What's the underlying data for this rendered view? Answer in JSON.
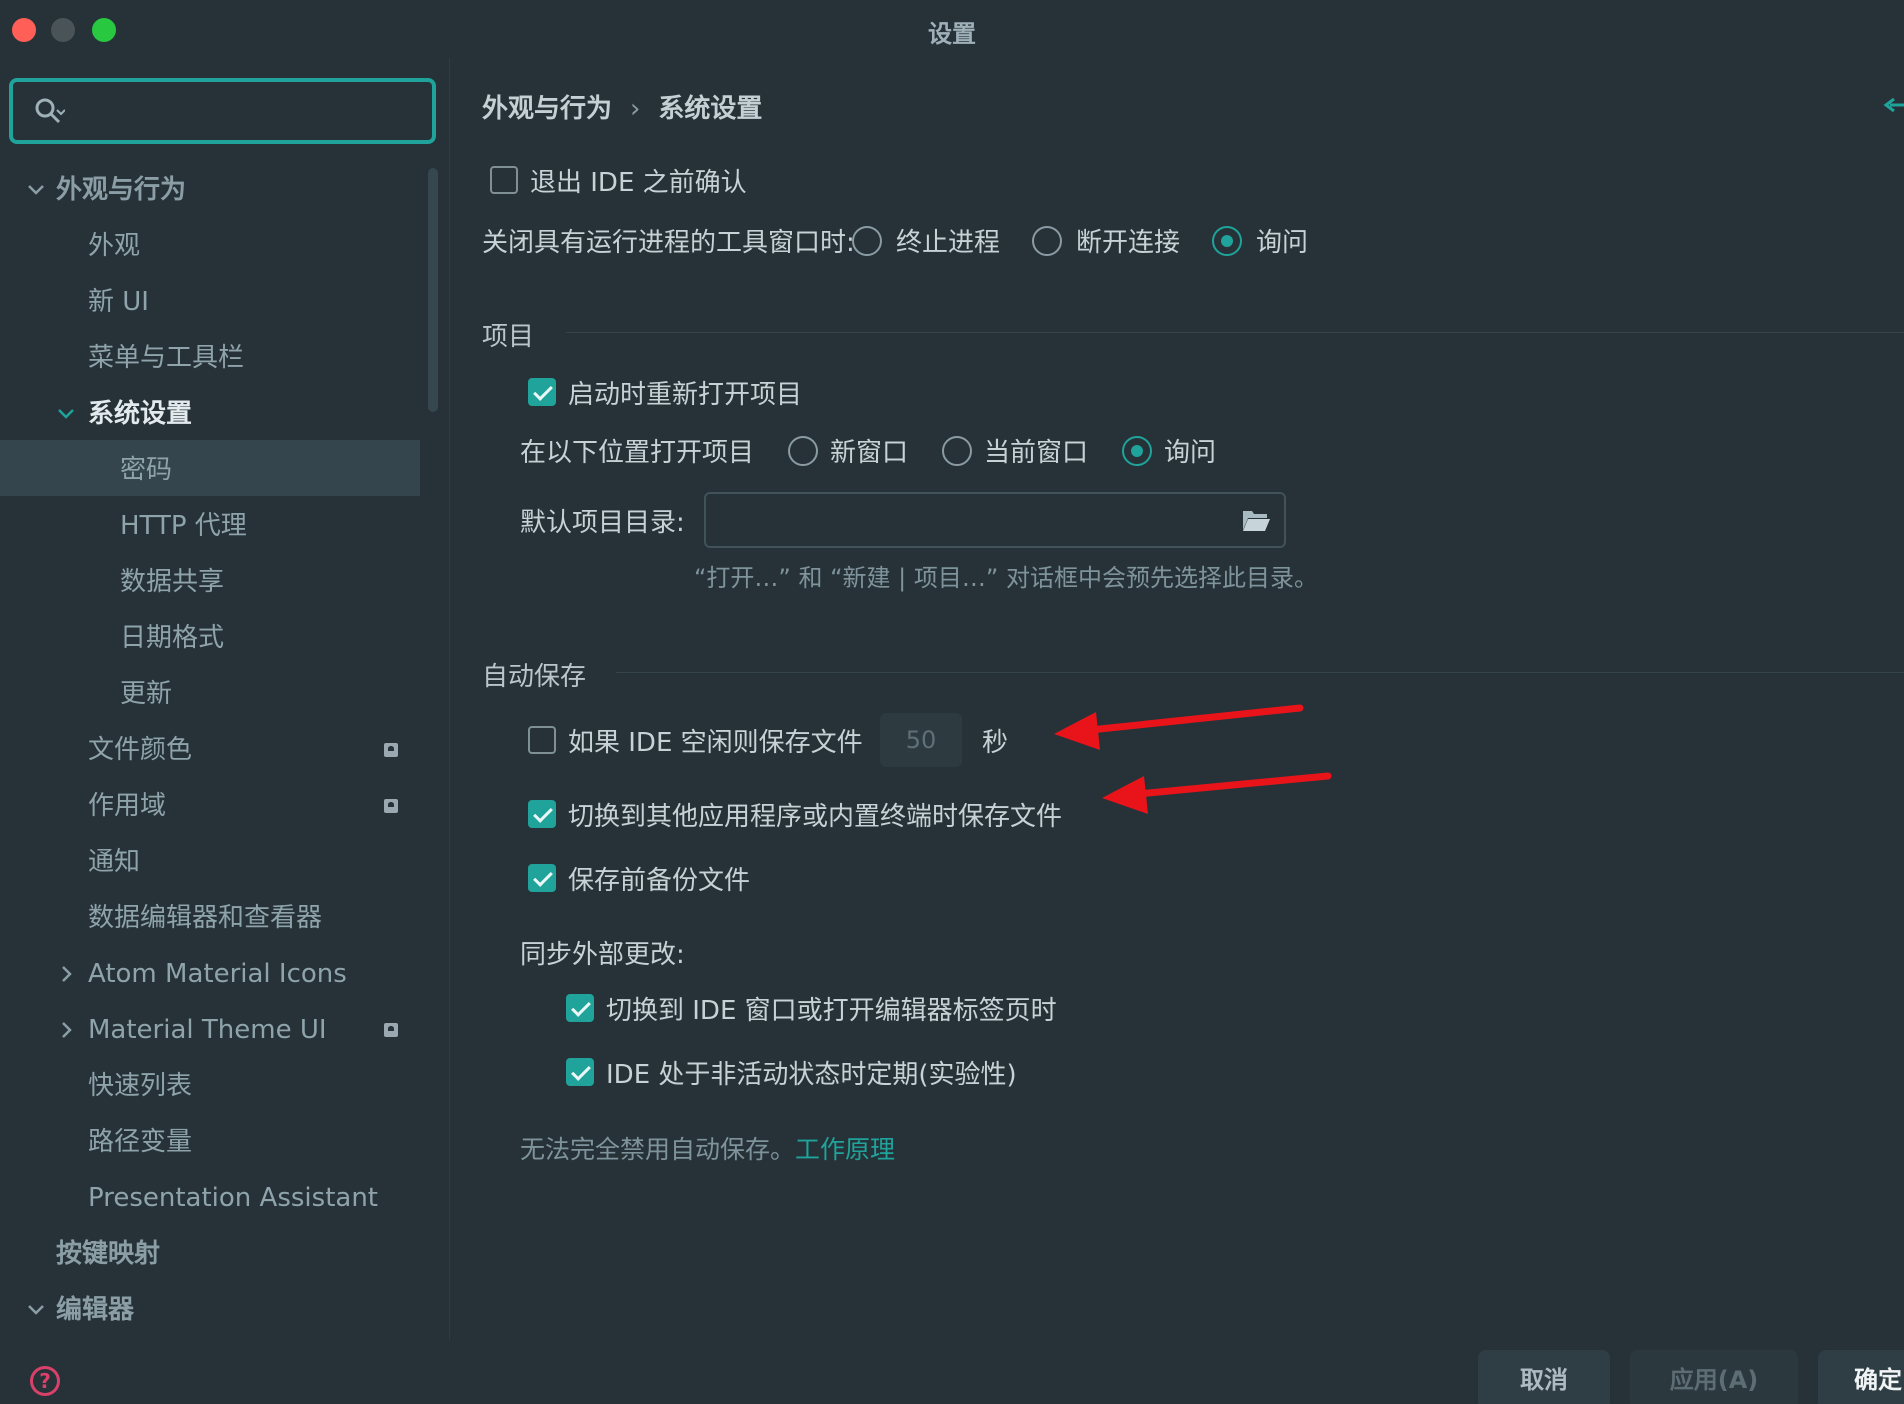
{
  "window": {
    "title": "设置"
  },
  "search": {
    "placeholder": ""
  },
  "sidebar": {
    "items": [
      {
        "label": "外观与行为",
        "level": 0,
        "group": true,
        "expanded": true
      },
      {
        "label": "外观",
        "level": 1
      },
      {
        "label": "新 UI",
        "level": 1
      },
      {
        "label": "菜单与工具栏",
        "level": 1
      },
      {
        "label": "系统设置",
        "level": 1,
        "expanded": true,
        "selected": true
      },
      {
        "label": "密码",
        "level": 2
      },
      {
        "label": "HTTP 代理",
        "level": 2
      },
      {
        "label": "数据共享",
        "level": 2
      },
      {
        "label": "日期格式",
        "level": 2
      },
      {
        "label": "更新",
        "level": 2
      },
      {
        "label": "文件颜色",
        "level": 1,
        "badge": true
      },
      {
        "label": "作用域",
        "level": 1,
        "badge": true
      },
      {
        "label": "通知",
        "level": 1
      },
      {
        "label": "数据编辑器和查看器",
        "level": 1
      },
      {
        "label": "Atom Material Icons",
        "level": 1,
        "collapsed": true
      },
      {
        "label": "Material Theme UI",
        "level": 1,
        "collapsed": true,
        "badge": true
      },
      {
        "label": "快速列表",
        "level": 1
      },
      {
        "label": "路径变量",
        "level": 1
      },
      {
        "label": "Presentation Assistant",
        "level": 1
      },
      {
        "label": "按键映射",
        "level": 0,
        "group": true
      },
      {
        "label": "编辑器",
        "level": 0,
        "group": true,
        "expanded": true
      }
    ]
  },
  "breadcrumb": {
    "parent": "外观与行为",
    "sep": "›",
    "current": "系统设置"
  },
  "settings": {
    "confirm_exit": {
      "label": "退出 IDE 之前确认",
      "checked": false
    },
    "close_tool_window": {
      "label": "关闭具有运行进程的工具窗口时:",
      "options": [
        "终止进程",
        "断开连接",
        "询问"
      ],
      "selected": "询问"
    },
    "project_section": "项目",
    "reopen_projects": {
      "label": "启动时重新打开项目",
      "checked": true
    },
    "open_project_in": {
      "label": "在以下位置打开项目",
      "options": [
        "新窗口",
        "当前窗口",
        "询问"
      ],
      "selected": "询问"
    },
    "default_dir": {
      "label": "默认项目目录:",
      "value": ""
    },
    "default_dir_hint": "“打开…” 和 “新建 | 项目…” 对话框中会预先选择此目录。",
    "autosave_section": "自动保存",
    "save_idle": {
      "label": "如果 IDE 空闲则保存文件",
      "checked": false,
      "value": "50",
      "unit": "秒"
    },
    "save_on_switch": {
      "label": "切换到其他应用程序或内置终端时保存文件",
      "checked": true
    },
    "backup_before_save": {
      "label": "保存前备份文件",
      "checked": true
    },
    "sync_label": "同步外部更改:",
    "sync_on_switch": {
      "label": "切换到 IDE 窗口或打开编辑器标签页时",
      "checked": true
    },
    "sync_periodic": {
      "label": "IDE 处于非活动状态时定期(实验性)",
      "checked": true
    },
    "autosave_note": "无法完全禁用自动保存。",
    "autosave_link": "工作原理"
  },
  "buttons": {
    "cancel": "取消",
    "apply": "应用(A)",
    "ok": "确定"
  },
  "colors": {
    "accent": "#1fa39a",
    "background": "#263238",
    "annotation_arrow": "#e8141a"
  }
}
